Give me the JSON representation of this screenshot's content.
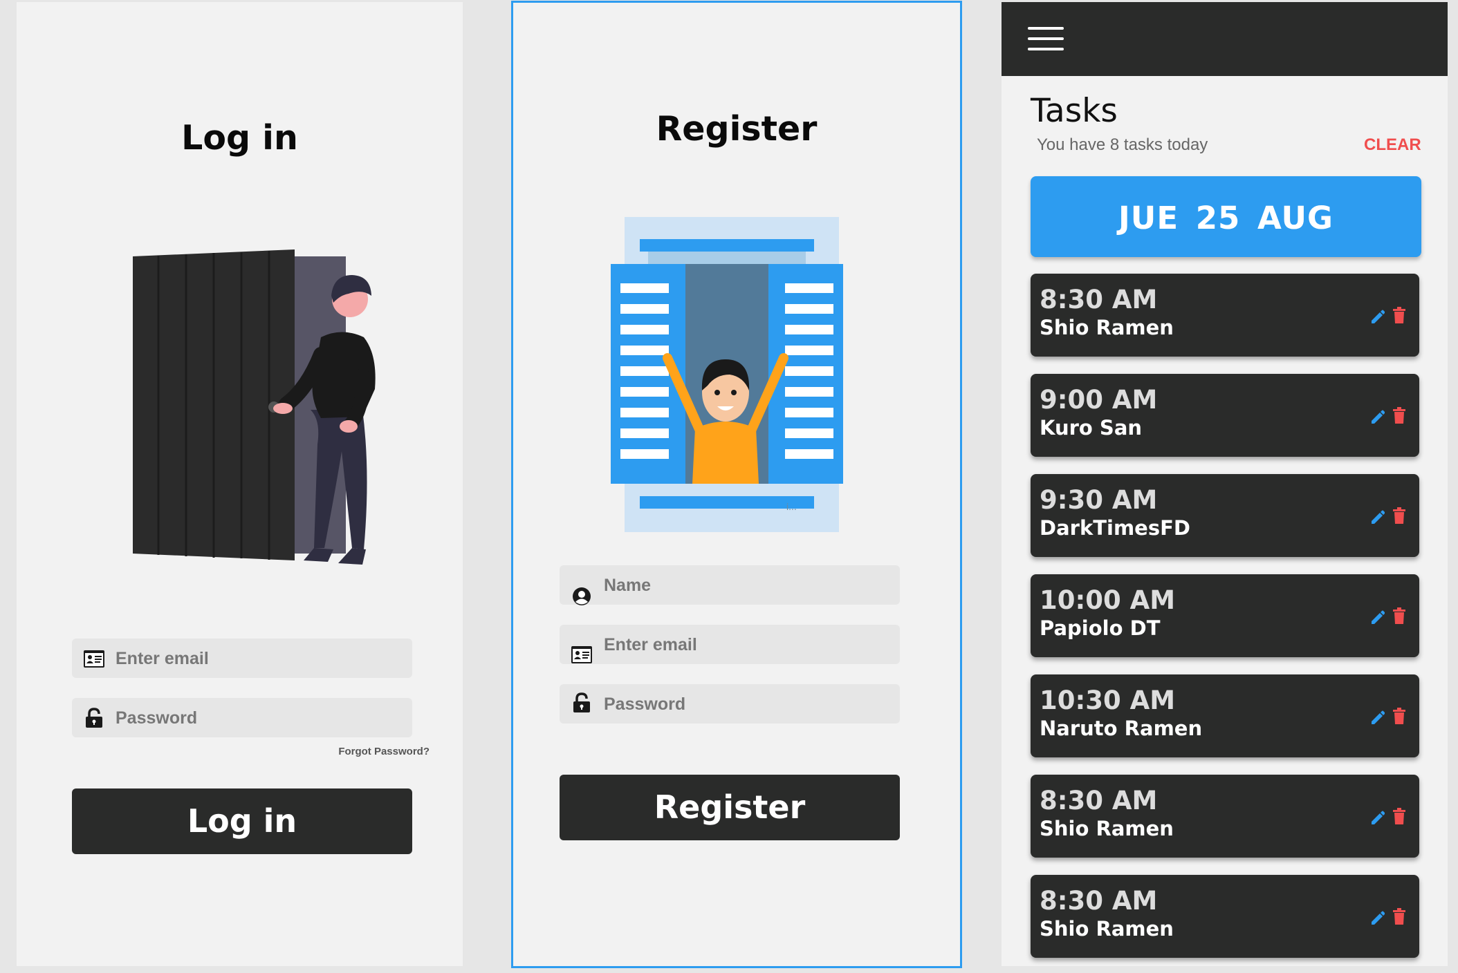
{
  "login": {
    "title": "Log in",
    "email_placeholder": "Enter email",
    "password_placeholder": "Password",
    "forgot_password": "Forgot Password?",
    "button_label": "Log in"
  },
  "register": {
    "title": "Register",
    "name_placeholder": "Name",
    "email_placeholder": "Enter email",
    "password_placeholder": "Password",
    "button_label": "Register",
    "illustration_caption": "i..."
  },
  "tasks": {
    "title": "Tasks",
    "subtitle": "You have 8 tasks today",
    "clear_label": "CLEAR",
    "date": "JUE 25 AUG",
    "items": [
      {
        "time": "8:30 AM",
        "name": "Shio Ramen"
      },
      {
        "time": "9:00 AM",
        "name": "Kuro San"
      },
      {
        "time": "9:30 AM",
        "name": "DarkTimesFD"
      },
      {
        "time": "10:00 AM",
        "name": "Papiolo DT"
      },
      {
        "time": "10:30 AM",
        "name": "Naruto Ramen"
      },
      {
        "time": "8:30 AM",
        "name": "Shio Ramen"
      },
      {
        "time": "8:30 AM",
        "name": "Shio Ramen"
      }
    ]
  },
  "icons": {
    "menu": "hamburger-menu-icon",
    "email": "id-card-icon",
    "password": "unlock-icon",
    "name": "user-circle-icon",
    "edit": "pencil-icon",
    "delete": "trash-icon"
  },
  "colors": {
    "accent": "#2d9cf0",
    "dark": "#2a2b2a",
    "danger": "#f04e4e",
    "panel": "#f2f2f2"
  }
}
